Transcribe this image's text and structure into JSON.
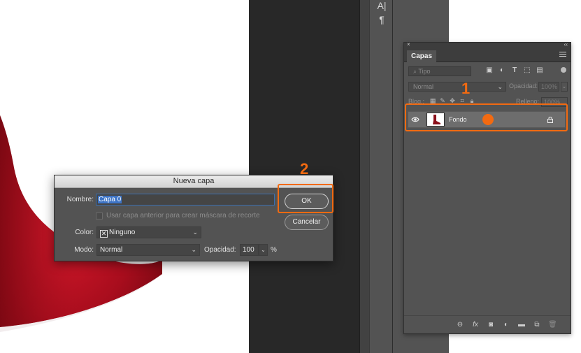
{
  "toolstrip": {
    "items": [
      {
        "icon": "character-panel-icon",
        "glyph": "A|"
      },
      {
        "icon": "paragraph-panel-icon",
        "glyph": "¶"
      }
    ]
  },
  "layers_panel": {
    "tab_label": "Capas",
    "filter": {
      "label": "Tipo"
    },
    "blend_mode": "Normal",
    "opacity_label": "Opacidad:",
    "opacity_value": "100%",
    "lock_label": "Bloq.:",
    "fill_label": "Relleno:",
    "fill_value": "100%",
    "layers": [
      {
        "name": "Fondo",
        "visible": true,
        "locked": true
      }
    ],
    "bottom_icons": [
      "link-icon",
      "fx-icon",
      "mask-icon",
      "adjustment-icon",
      "group-folder-icon",
      "new-layer-icon",
      "trash-icon"
    ]
  },
  "annotations": {
    "step1": "1",
    "step2": "2",
    "highlight_color": "#f26a11"
  },
  "dialog": {
    "title": "Nueva capa",
    "name_label": "Nombre:",
    "name_value": "Capa 0",
    "clip_mask_label": "Usar capa anterior para crear máscara de recorte",
    "color_label": "Color:",
    "color_value": "Ninguno",
    "mode_label": "Modo:",
    "mode_value": "Normal",
    "opacity_label": "Opacidad:",
    "opacity_value": "100",
    "opacity_unit": "%",
    "ok_label": "OK",
    "cancel_label": "Cancelar"
  }
}
